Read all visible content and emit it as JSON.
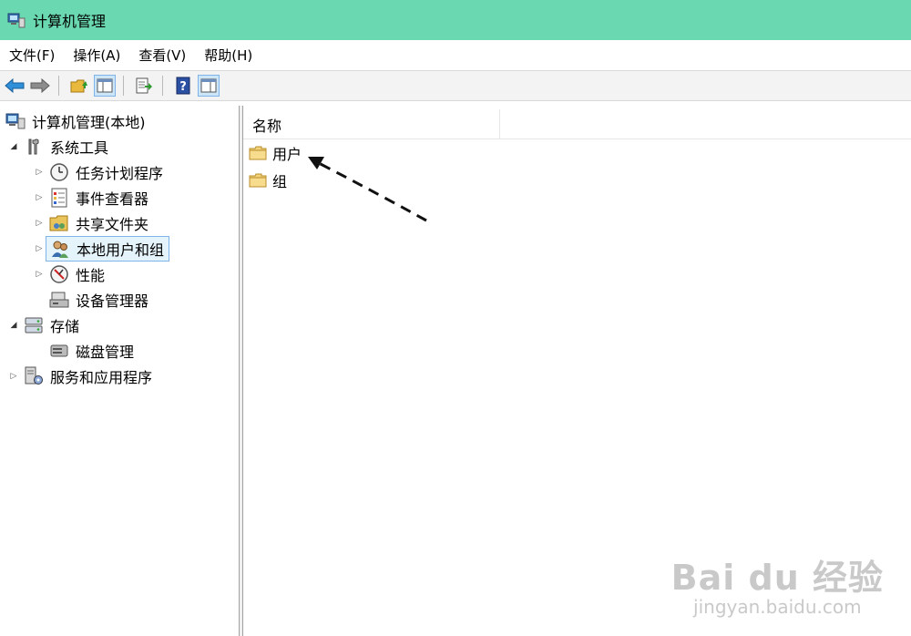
{
  "window": {
    "title": "计算机管理"
  },
  "menu": [
    {
      "label": "文件(F)"
    },
    {
      "label": "操作(A)"
    },
    {
      "label": "查看(V)"
    },
    {
      "label": "帮助(H)"
    }
  ],
  "toolbar": {
    "buttons": [
      "back-arrow-icon",
      "forward-arrow-icon",
      "up-folder-icon",
      "show-hide-tree-icon",
      "export-list-icon",
      "help-icon",
      "show-hide-action-pane-icon"
    ]
  },
  "tree": {
    "root": "计算机管理(本地)",
    "system_tools": "系统工具",
    "task_scheduler": "任务计划程序",
    "event_viewer": "事件查看器",
    "shared_folders": "共享文件夹",
    "local_users_groups": "本地用户和组",
    "performance": "性能",
    "device_manager": "设备管理器",
    "storage": "存储",
    "disk_management": "磁盘管理",
    "services_apps": "服务和应用程序"
  },
  "list": {
    "column_name": "名称",
    "items": [
      "用户",
      "组"
    ]
  },
  "watermark": {
    "brand": "Bai du 经验",
    "url": "jingyan.baidu.com"
  },
  "colors": {
    "titlebar": "#6ad9b1",
    "selection": "#e5f3fb",
    "selection_border": "#7eb4ea"
  }
}
